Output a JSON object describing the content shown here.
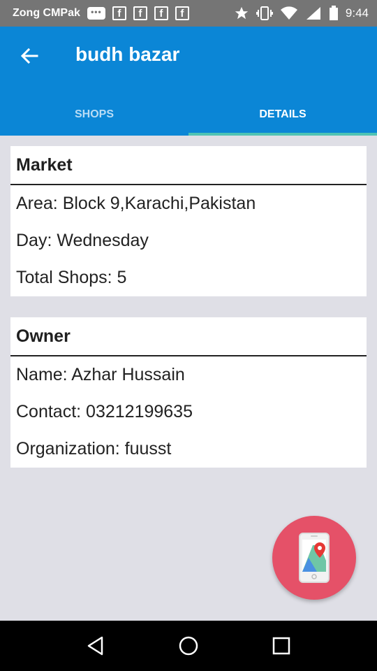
{
  "status_bar": {
    "carrier": "Zong CMPak",
    "chat_badge": "•••",
    "notification_letters": [
      "f",
      "f",
      "f",
      "f"
    ],
    "time": "9:44"
  },
  "app_bar": {
    "title": "budh bazar",
    "tabs": [
      {
        "label": "SHOPS",
        "active": false
      },
      {
        "label": "DETAILS",
        "active": true
      }
    ]
  },
  "market_card": {
    "heading": "Market",
    "rows": [
      "Area: Block 9,Karachi,Pakistan",
      "Day: Wednesday",
      "Total Shops: 5"
    ]
  },
  "owner_card": {
    "heading": "Owner",
    "rows": [
      "Name: Azhar Hussain",
      "Contact: 03212199635",
      "Organization: fuusst"
    ]
  },
  "fab": {
    "icon": "phone-map-icon",
    "color": "#e55168"
  },
  "colors": {
    "primary": "#0b86d6",
    "tab_indicator": "#4fc3b4",
    "background": "#dfdfe6"
  },
  "nav_bar": {
    "icons": [
      "back-triangle-icon",
      "home-circle-icon",
      "recents-square-icon"
    ]
  }
}
